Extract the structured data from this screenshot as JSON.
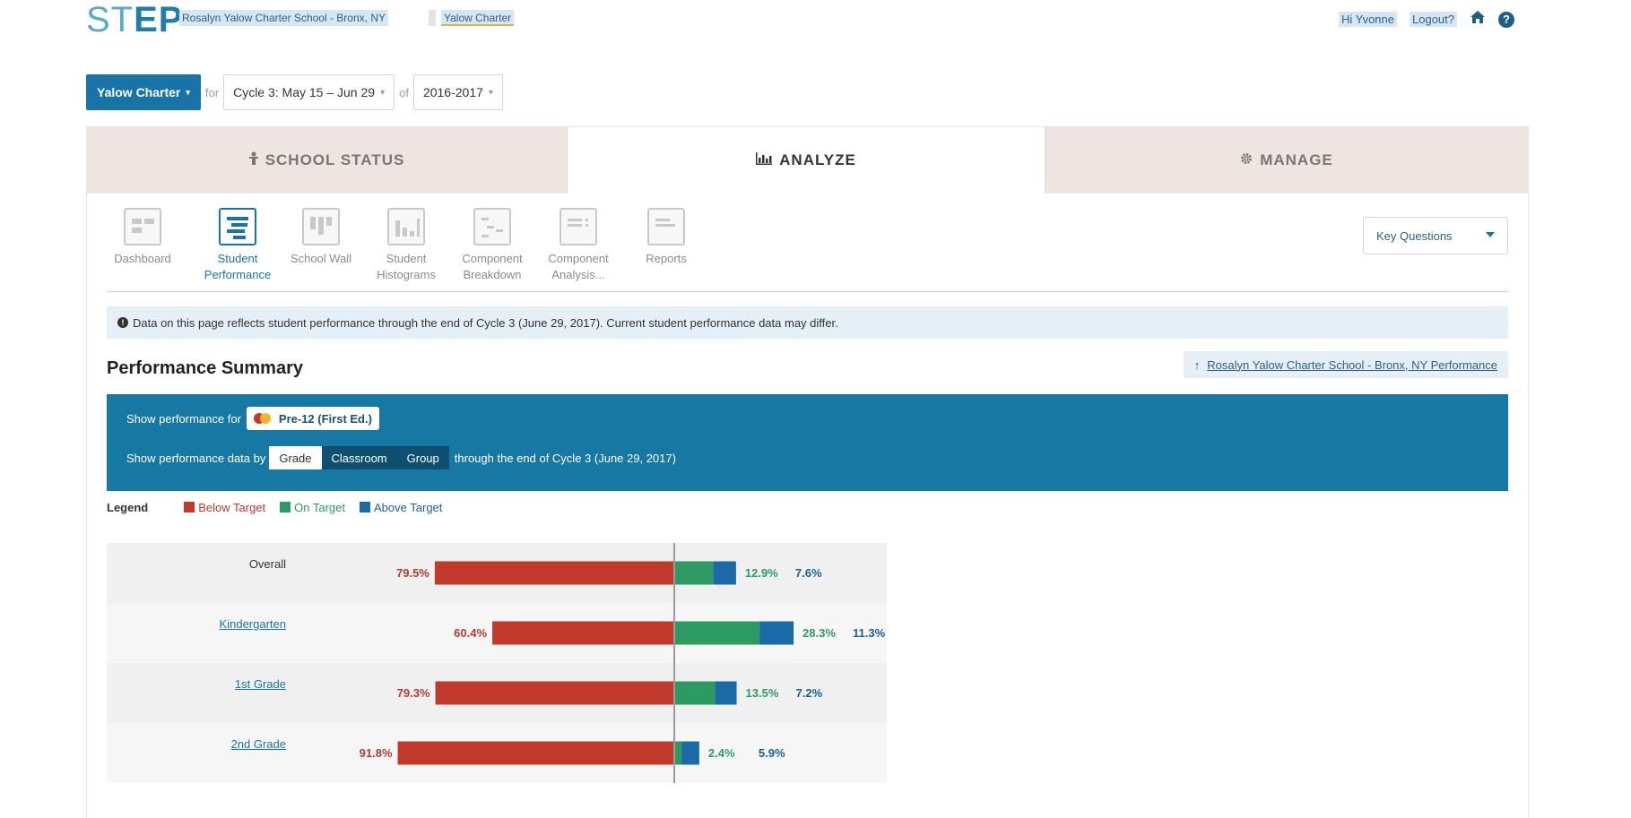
{
  "app": {
    "logo_st": "ST",
    "logo_ep": "EP",
    "breadcrumb_school": "Rosalyn Yalow Charter School - Bronx, NY",
    "breadcrumb_charter": "Yalow Charter"
  },
  "user": {
    "greeting": "Hi Yvonne",
    "logout_label": "Logout?",
    "home_icon": "home-icon",
    "help_icon": "help-icon"
  },
  "filters": {
    "school_label": "Yalow Charter",
    "for_label": "for",
    "cycle_label": "Cycle 3: May 15 – Jun 29",
    "of_label": "of",
    "year_label": "2016-2017"
  },
  "tabs": [
    {
      "label": "SCHOOL STATUS",
      "icon": "person-icon"
    },
    {
      "label": "ANALYZE",
      "icon": "bar-chart-icon"
    },
    {
      "label": "MANAGE",
      "icon": "gear-icon"
    }
  ],
  "subnav": {
    "items": [
      {
        "label": "Dashboard",
        "icon": "dashboard-icon"
      },
      {
        "label": "Student Performance",
        "icon": "student-performance-icon"
      },
      {
        "label": "School Wall",
        "icon": "school-wall-icon"
      },
      {
        "label": "Student Histograms",
        "icon": "histogram-icon"
      },
      {
        "label": "Component Breakdown",
        "icon": "component-breakdown-icon"
      },
      {
        "label": "Component Analysis...",
        "icon": "component-analysis-icon"
      },
      {
        "label": "Reports",
        "icon": "reports-icon"
      }
    ],
    "key_questions_label": "Key Questions"
  },
  "info_banner": "Data on this page reflects student performance through the end of Cycle 3 (June 29, 2017). Current student performance data may differ.",
  "performance": {
    "title": "Performance Summary",
    "school_link": "Rosalyn Yalow Charter School - Bronx, NY Performance",
    "show_for_label": "Show performance for",
    "show_for_value": "Pre-12 (First Ed.)",
    "show_by_label": "Show performance data by",
    "show_by_options": [
      "Grade",
      "Classroom",
      "Group"
    ],
    "through_label": "through the end of Cycle 3 (June 29, 2017)"
  },
  "legend": {
    "title": "Legend",
    "items": [
      {
        "label": "Below Target",
        "color": "#c0392b"
      },
      {
        "label": "On Target",
        "color": "#2e9a63"
      },
      {
        "label": "Above Target",
        "color": "#1a6aa8"
      }
    ]
  },
  "chart_data": {
    "type": "bar",
    "orientation": "horizontal-diverging",
    "categories": [
      "Overall",
      "Kindergarten",
      "1st Grade",
      "2nd Grade"
    ],
    "series": [
      {
        "name": "Below Target",
        "values": [
          79.5,
          60.4,
          79.3,
          91.8
        ],
        "labels": [
          "79.5%",
          "60.4%",
          "79.3%",
          "91.8%"
        ]
      },
      {
        "name": "On Target",
        "values": [
          12.9,
          28.3,
          13.5,
          2.4
        ],
        "labels": [
          "12.9%",
          "28.3%",
          "13.5%",
          "2.4%"
        ]
      },
      {
        "name": "Above Target",
        "values": [
          7.6,
          11.3,
          7.2,
          5.9
        ],
        "labels": [
          "7.6%",
          "11.3%",
          "7.2%",
          "5.9%"
        ]
      }
    ],
    "colors": {
      "below": "#c0392b",
      "on": "#2e9a63",
      "above": "#1a6aa8"
    }
  }
}
